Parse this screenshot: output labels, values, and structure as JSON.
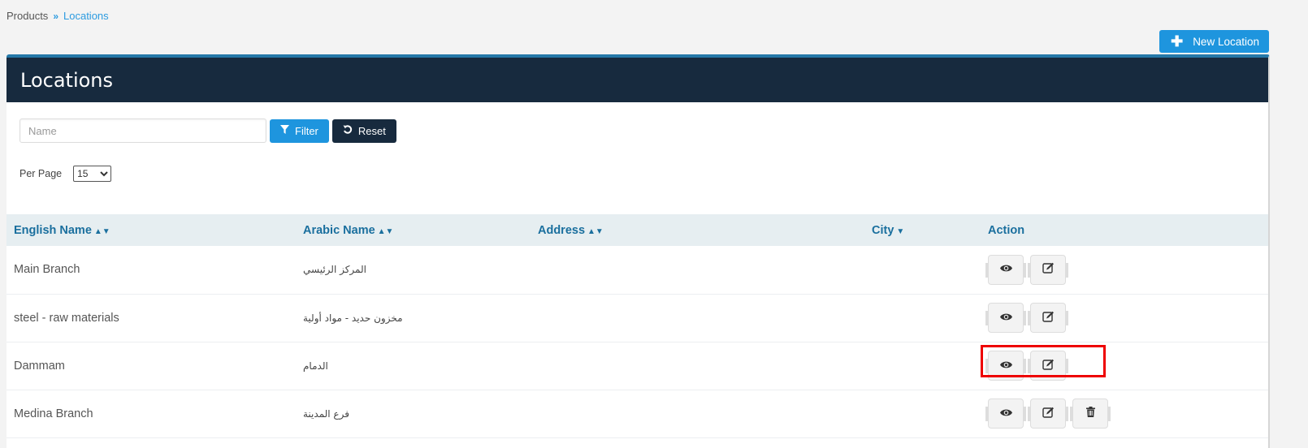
{
  "breadcrumb": [
    {
      "label": "Products"
    },
    {
      "label": "Locations"
    }
  ],
  "breadcrumb_separator": "»",
  "new_location_label": "New Location",
  "panel_title": "Locations",
  "filter": {
    "name_placeholder": "Name",
    "name_value": "",
    "filter_label": "Filter",
    "reset_label": "Reset"
  },
  "per_page": {
    "label": "Per Page",
    "selected": "15"
  },
  "table": {
    "columns": [
      {
        "label": "English Name",
        "sort": "both"
      },
      {
        "label": "Arabic Name",
        "sort": "both"
      },
      {
        "label": "Address",
        "sort": "both"
      },
      {
        "label": "City",
        "sort": "desc"
      },
      {
        "label": "Action",
        "sort": "none"
      }
    ],
    "rows": [
      {
        "english_name": "Main Branch",
        "arabic_name": "المركز الرئيسي",
        "address": "",
        "city": "",
        "actions": [
          "view",
          "edit"
        ]
      },
      {
        "english_name": "steel - raw materials",
        "arabic_name": "مخزون حديد - مواد أولية",
        "address": "",
        "city": "",
        "actions": [
          "view",
          "edit"
        ]
      },
      {
        "english_name": "Dammam",
        "arabic_name": "الدمام",
        "address": "",
        "city": "",
        "actions": [
          "view",
          "edit"
        ]
      },
      {
        "english_name": "Medina Branch",
        "arabic_name": "فرع المدينة",
        "address": "",
        "city": "",
        "actions": [
          "view",
          "edit",
          "delete"
        ]
      }
    ]
  },
  "colors": {
    "accent": "#1e95de",
    "header_dark": "#172a3e",
    "panel_top_border": "#2578a8",
    "table_header_bg": "#e6eef1",
    "table_header_text": "#1a6f9e",
    "highlight": "#ee0000"
  }
}
